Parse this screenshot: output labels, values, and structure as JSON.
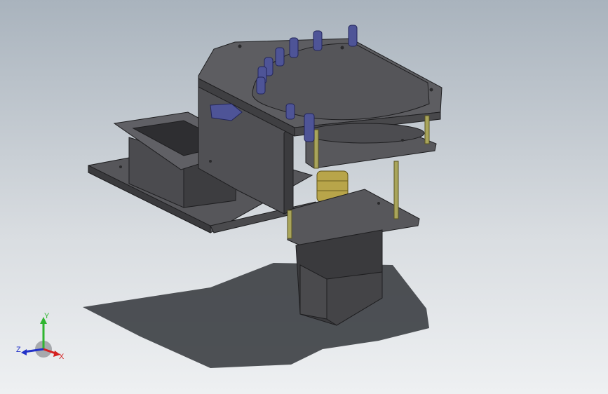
{
  "viewport": {
    "background_top": "#a9b3bd",
    "background_bottom": "#eef0f2"
  },
  "colors": {
    "part_dark": "#4a4a4d",
    "part_mid": "#5b5b5f",
    "part_light": "#77777c",
    "edge": "#1e1e20",
    "pin_blue": "#4e5497",
    "pin_blue_light": "#7d82c4",
    "rod_yellow": "#a9a55b",
    "coupling_gold": "#b8a54a",
    "shadow": "#3f4246"
  },
  "triad": {
    "x_label": "X",
    "y_label": "Y",
    "z_label": "Z",
    "x_color": "#d42121",
    "y_color": "#2fb52f",
    "z_color": "#2131c8"
  }
}
